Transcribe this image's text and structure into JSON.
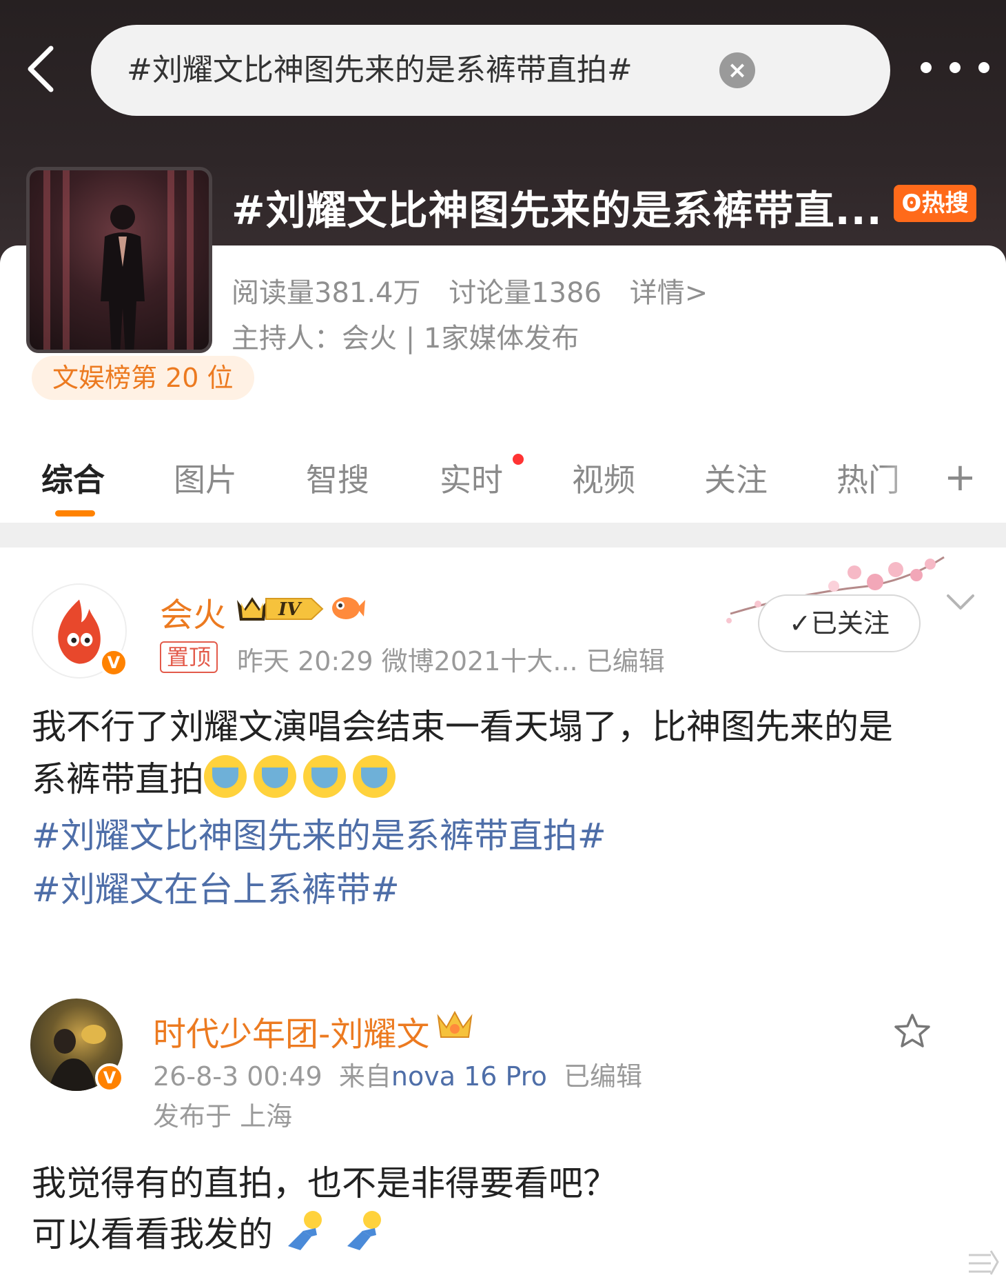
{
  "header": {
    "search_query": "#刘耀文比神图先来的是系裤带直拍#",
    "clear_symbol": "×"
  },
  "topic": {
    "title": "#刘耀文比神图先来的是系裤带直...",
    "hot_badge": "热搜",
    "reads": "阅读量381.4万",
    "discussions": "讨论量1386",
    "details": "详情>",
    "host_line": "主持人：会火 | 1家媒体发布",
    "rank": "文娱榜第 20 位"
  },
  "tabs": [
    {
      "label": "综合"
    },
    {
      "label": "图片"
    },
    {
      "label": "智搜"
    },
    {
      "label": "实时"
    },
    {
      "label": "视频"
    },
    {
      "label": "关注"
    },
    {
      "label": "热门"
    },
    {
      "label": "+"
    }
  ],
  "post1": {
    "author": "会火",
    "level": "IV",
    "pinned": "置顶",
    "meta": "昨天 20:29  微博2021十大...  已编辑",
    "follow": "✓已关注",
    "text_line1": "我不行了刘耀文演唱会结束一看天塌了，比神图先来的是",
    "text_line2": "系裤带直拍",
    "hashtag1": "#刘耀文比神图先来的是系裤带直拍#",
    "hashtag2": "#刘耀文在台上系裤带#",
    "verified": "V"
  },
  "post2": {
    "author": "时代少年团-刘耀文",
    "time": "26-8-3 00:49",
    "from": "来自",
    "source": "nova 16 Pro",
    "edited": "已编辑",
    "location": "发布于 上海",
    "text_line1": "我觉得有的直拍，也不是非得要看吧？",
    "text_line2": "可以看看我发的",
    "verified": "V"
  },
  "colors": {
    "accent_orange": "#ff8200",
    "link_blue": "#4e6ea8",
    "hot_badge": "#ff6a1a"
  }
}
